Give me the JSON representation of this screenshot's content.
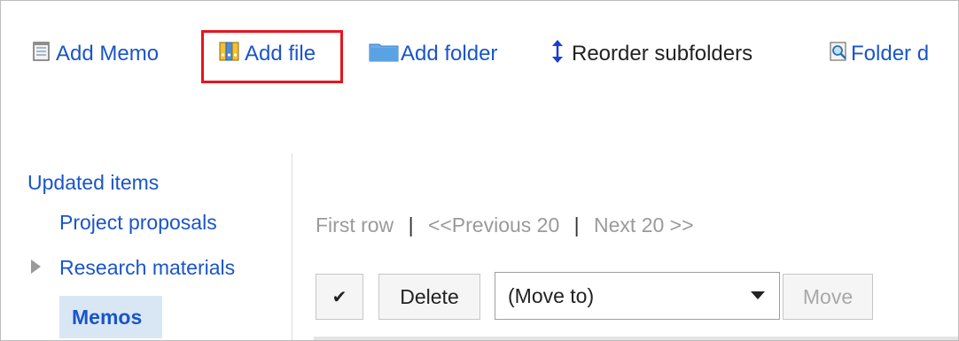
{
  "toolbar": {
    "add_memo": "Add Memo",
    "add_file": "Add file",
    "add_folder": "Add folder",
    "reorder_subfolders": "Reorder subfolders",
    "folder_details": "Folder d"
  },
  "highlight_color": "#e8141c",
  "sidebar": {
    "updated_items": "Updated items",
    "items": [
      {
        "label": "Project proposals"
      },
      {
        "label": "Research materials"
      },
      {
        "label": "Memos"
      }
    ]
  },
  "pager": {
    "first_row": "First row",
    "separator": "|",
    "previous": "<<Previous 20",
    "next": "Next 20 >>"
  },
  "actions": {
    "check_symbol": "✔",
    "delete_label": "Delete",
    "move_select_value": "(Move to)",
    "move_label": "Move"
  },
  "icons": [
    "memo-icon",
    "file-icon",
    "folder-icon",
    "reorder-icon",
    "folder-detail-icon",
    "collapsed-triangle-icon",
    "dropdown-arrow-icon"
  ]
}
